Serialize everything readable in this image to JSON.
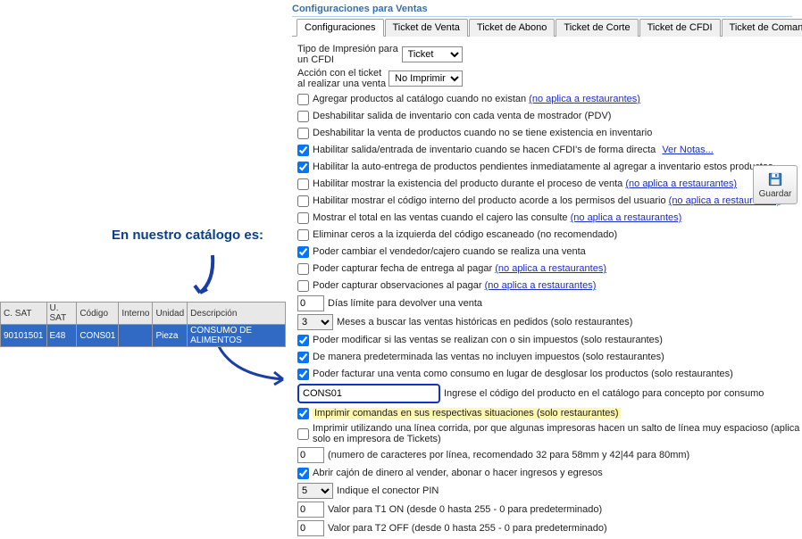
{
  "group_title": "Configuraciones para Ventas",
  "catalog_label": "En nuestro catálogo es:",
  "tabs": [
    "Configuraciones",
    "Ticket de Venta",
    "Ticket de Abono",
    "Ticket de Corte",
    "Ticket de CFDI",
    "Ticket de Comanda"
  ],
  "active_tab": 0,
  "catalog_table": {
    "headers": [
      "C. SAT",
      "U. SAT",
      "Código",
      "Interno",
      "Unidad",
      "Descripción"
    ],
    "row": [
      "90101501",
      "E48",
      "CONS01",
      "",
      "Pieza",
      "CONSUMO DE ALIMENTOS"
    ]
  },
  "row_tipo_impresion": {
    "label": "Tipo de Impresión para un CFDI",
    "value": "Ticket"
  },
  "row_accion_ticket": {
    "label": "Acción con el ticket al realizar una venta",
    "value": "No Imprimir"
  },
  "cb_agregar": {
    "label": "Agregar productos al catálogo cuando no existan ",
    "link": "(no aplica a restaurantes)",
    "checked": false
  },
  "cb_deshab_salida": {
    "label": "Deshabilitar salida de inventario con cada venta de mostrador (PDV)",
    "checked": false
  },
  "cb_deshab_venta": {
    "label": "Deshabilitar la venta de productos cuando no se tiene existencia en inventario",
    "checked": false
  },
  "cb_habilitar_cfdi": {
    "label": "Habilitar salida/entrada de inventario cuando se hacen CFDI's de forma directa ",
    "link": "Ver Notas...",
    "checked": true
  },
  "cb_auto_entrega": {
    "label": "Habilitar la auto-entrega de productos pendientes inmediatamente al agregar a inventario estos productos",
    "checked": true
  },
  "cb_existencia": {
    "label": "Habilitar mostrar la existencia del producto durante el proceso de venta ",
    "link": "(no aplica a restaurantes)",
    "checked": false
  },
  "cb_codigo_interno": {
    "label": "Habilitar mostrar el código interno del producto acorde a los permisos del usuario ",
    "link": "(no aplica a restaurantes)",
    "checked": false
  },
  "cb_mostrar_total": {
    "label": "Mostrar el total en las ventas cuando el cajero las consulte ",
    "link": "(no aplica a restaurantes)",
    "checked": false
  },
  "cb_eliminar_ceros": {
    "label": "Eliminar ceros a la izquierda del código escaneado (no recomendado)",
    "checked": false
  },
  "cb_cambiar_vendedor": {
    "label": "Poder cambiar el vendedor/cajero cuando se realiza una venta",
    "checked": true
  },
  "cb_fecha_entrega": {
    "label": "Poder capturar fecha de entrega al pagar ",
    "link": "(no aplica a restaurantes)",
    "checked": false
  },
  "cb_observaciones": {
    "label": "Poder capturar observaciones al pagar ",
    "link": "(no aplica a restaurantes)",
    "checked": false
  },
  "dias_devolver": {
    "value": "0",
    "label": "Días límite para devolver una venta"
  },
  "meses_buscar": {
    "value": "3",
    "label": "Meses a buscar las ventas históricas en pedidos (solo restaurantes)"
  },
  "cb_modificar_impuestos": {
    "label": "Poder modificar si las ventas se realizan con o sin impuestos (solo restaurantes)",
    "checked": true
  },
  "cb_predeterminada": {
    "label": "De manera predeterminada las ventas no incluyen impuestos (solo restaurantes)",
    "checked": true
  },
  "cb_facturar_consumo": {
    "label": "Poder facturar una venta como consumo en lugar de desglosar los productos (solo restaurantes)",
    "checked": true
  },
  "codigo_consumo": {
    "value": "CONS01",
    "label": "Ingrese el código del producto en el catálogo para concepto por consumo"
  },
  "cb_imprimir_comandas": {
    "label": "Imprimir comandas en sus respectivas situaciones ",
    "hl": "(solo restaurantes)",
    "checked": true
  },
  "cb_linea_corrida": {
    "label": "Imprimir utilizando una línea corrida, por que algunas impresoras hacen un salto de línea muy espacioso (aplica solo en impresora de Tickets)",
    "checked": false
  },
  "num_caracteres": {
    "value": "0",
    "label": "(numero de caracteres por línea, recomendado 32 para 58mm y 42|44 para 80mm)"
  },
  "cb_abrir_cajon": {
    "label": "Abrir cajón de dinero al vender, abonar o hacer ingresos y egresos",
    "checked": true
  },
  "conector_pin": {
    "value": "5",
    "label": "Indique el conector PIN"
  },
  "t1_on": {
    "value": "0",
    "label": "Valor para T1 ON (desde 0 hasta 255 - 0 para predeterminado)"
  },
  "t2_off": {
    "value": "0",
    "label": "Valor para T2 OFF (desde 0 hasta 255 - 0 para predeterminado)"
  },
  "save_label": "Guardar"
}
